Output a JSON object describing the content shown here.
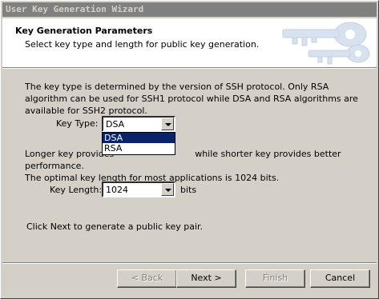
{
  "window": {
    "title": "User Key Generation Wizard"
  },
  "header": {
    "title": "Key Generation Parameters",
    "subtitle": "Select key type and length for public key generation."
  },
  "body": {
    "type_description": "The key type is determined by the version of SSH protocol. Only RSA algorithm can be used for SSH1 protocol while DSA and RSA algorithms are available for SSH2 protocol.",
    "key_type_label": "Key Type:",
    "key_type_value": "DSA",
    "key_type_options": [
      "DSA",
      "RSA"
    ],
    "length_line1_visible": "Longer key provides",
    "length_line1_tail": "while shorter key provides better performance.",
    "length_line2": "The optimal key length for most applications is 1024 bits.",
    "key_length_label": "Key Length:",
    "key_length_value": "1024",
    "key_length_unit": "bits",
    "next_hint": "Click Next to generate a public key pair."
  },
  "buttons": {
    "back": "< Back",
    "next": "Next >",
    "finish": "Finish",
    "cancel": "Cancel"
  },
  "colors": {
    "selection": "#0a246a",
    "face": "#d4d0c8",
    "header_art": "#d8e2ef"
  }
}
